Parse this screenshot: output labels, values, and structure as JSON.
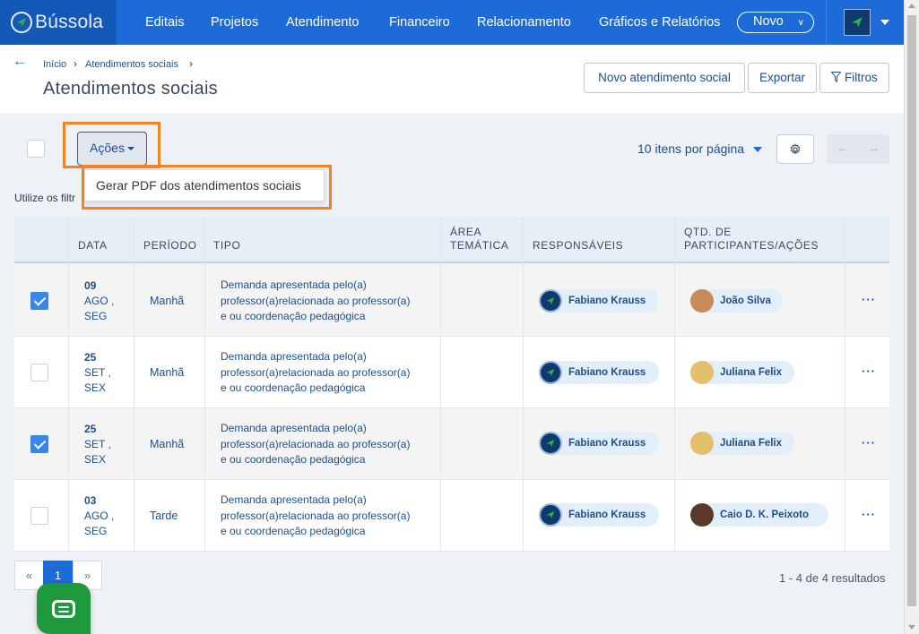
{
  "brand": {
    "name": "Bússola"
  },
  "nav": {
    "items": [
      "Editais",
      "Projetos",
      "Atendimento",
      "Financeiro",
      "Relacionamento",
      "Gráficos e Relatórios"
    ],
    "novo_label": "Novo"
  },
  "breadcrumb": {
    "home": "Início",
    "current": "Atendimentos sociais",
    "separator": "›"
  },
  "page": {
    "title": "Atendimentos sociais"
  },
  "header_buttons": {
    "new": "Novo atendimento social",
    "export": "Exportar",
    "filters": "Filtros"
  },
  "toolbar": {
    "acoes_label": "Ações",
    "dropdown_item": "Gerar PDF dos atendimentos sociais",
    "hint": "Utilize os filtr",
    "per_page": "10 itens por página"
  },
  "table": {
    "headers": {
      "data": "DATA",
      "periodo": "PERÍODO",
      "tipo": "TIPO",
      "area_line1": "ÁREA",
      "area_line2": "TEMÁTICA",
      "resp": "RESPONSÁVEIS",
      "qtd_line1": "QTD. DE",
      "qtd_line2": "PARTICIPANTES/AÇÕES"
    },
    "rows": [
      {
        "checked": true,
        "day": "09",
        "month": "AGO ,",
        "weekday": "SEG",
        "periodo": "Manhã",
        "tipo_l1": "Demanda apresentada pelo(a)",
        "tipo_l2": "professor(a)relacionada ao professor(a)",
        "tipo_l3": "e ou coordenação pedagógica",
        "area": "",
        "responsavel": "Fabiano Krauss",
        "participante": "João Silva",
        "actions": "···"
      },
      {
        "checked": false,
        "day": "25",
        "month": "SET ,",
        "weekday": "SEX",
        "periodo": "Manhã",
        "tipo_l1": "Demanda apresentada pelo(a)",
        "tipo_l2": "professor(a)relacionada ao professor(a)",
        "tipo_l3": "e ou coordenação pedagógica",
        "area": "",
        "responsavel": "Fabiano Krauss",
        "participante": "Juliana Felix",
        "actions": "···"
      },
      {
        "checked": true,
        "day": "25",
        "month": "SET ,",
        "weekday": "SEX",
        "periodo": "Manhã",
        "tipo_l1": "Demanda apresentada pelo(a)",
        "tipo_l2": "professor(a)relacionada ao professor(a)",
        "tipo_l3": "e ou coordenação pedagógica",
        "area": "",
        "responsavel": "Fabiano Krauss",
        "participante": "Juliana Felix",
        "actions": "···"
      },
      {
        "checked": false,
        "day": "03",
        "month": "AGO ,",
        "weekday": "SEG",
        "periodo": "Tarde",
        "tipo_l1": "Demanda apresentada pelo(a)",
        "tipo_l2": "professor(a)relacionada ao professor(a)",
        "tipo_l3": "e ou coordenação pedagógica",
        "area": "",
        "responsavel": "Fabiano Krauss",
        "participante": "Caio D. K. Peixoto",
        "actions": "···"
      }
    ]
  },
  "pagination": {
    "prev": "«",
    "current": "1",
    "next": "»",
    "results": "1 - 4 de 4 resultados"
  },
  "colors": {
    "primary": "#1c6bd9",
    "brand_dark": "#1559b8",
    "highlight": "#f58220",
    "chat": "#1e9a3c",
    "checkbox": "#3a86e8"
  },
  "icons": [
    "compass-logo-icon",
    "back-arrow-icon",
    "filter-icon",
    "gear-icon",
    "chat-icon"
  ]
}
